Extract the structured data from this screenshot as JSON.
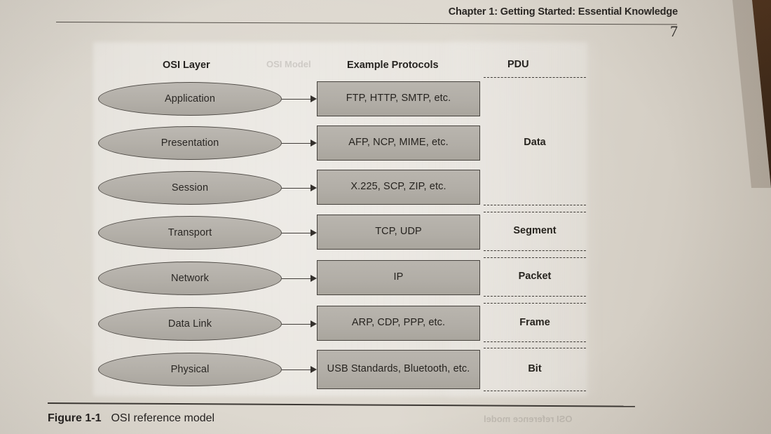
{
  "page": {
    "running_head": "Chapter 1:  Getting Started: Essential Knowledge",
    "page_number": "7",
    "ghost_text_top": "OSI Model",
    "ghost_text_bottom": "OSI reference model"
  },
  "figure": {
    "number": "Figure 1-1",
    "title": "OSI reference model"
  },
  "columns": {
    "osi_layer": "OSI Layer",
    "example_protocols": "Example Protocols",
    "pdu": "PDU"
  },
  "chart_data": {
    "type": "diagram",
    "title": "OSI reference model",
    "columns": [
      "OSI Layer",
      "Example Protocols",
      "PDU"
    ],
    "rows": [
      {
        "layer": "Application",
        "protocols": "FTP, HTTP, SMTP, etc.",
        "pdu": ""
      },
      {
        "layer": "Presentation",
        "protocols": "AFP, NCP, MIME, etc.",
        "pdu": "Data"
      },
      {
        "layer": "Session",
        "protocols": "X.225, SCP, ZIP, etc.",
        "pdu": ""
      },
      {
        "layer": "Transport",
        "protocols": "TCP, UDP",
        "pdu": "Segment"
      },
      {
        "layer": "Network",
        "protocols": "IP",
        "pdu": "Packet"
      },
      {
        "layer": "Data Link",
        "protocols": "ARP, CDP, PPP, etc.",
        "pdu": "Frame"
      },
      {
        "layer": "Physical",
        "protocols": "USB Standards, Bluetooth, etc.",
        "pdu": "Bit"
      }
    ],
    "pdu_groups": [
      {
        "label": "Data",
        "layers": [
          "Application",
          "Presentation",
          "Session"
        ]
      },
      {
        "label": "Segment",
        "layers": [
          "Transport"
        ]
      },
      {
        "label": "Packet",
        "layers": [
          "Network"
        ]
      },
      {
        "label": "Frame",
        "layers": [
          "Data Link"
        ]
      },
      {
        "label": "Bit",
        "layers": [
          "Physical"
        ]
      }
    ]
  },
  "colors": {
    "paper": "#ded9d0",
    "shape_fill": "#b3afa8",
    "shape_stroke": "#4e4a45",
    "text": "#26231f",
    "desk": "#3b2717"
  }
}
